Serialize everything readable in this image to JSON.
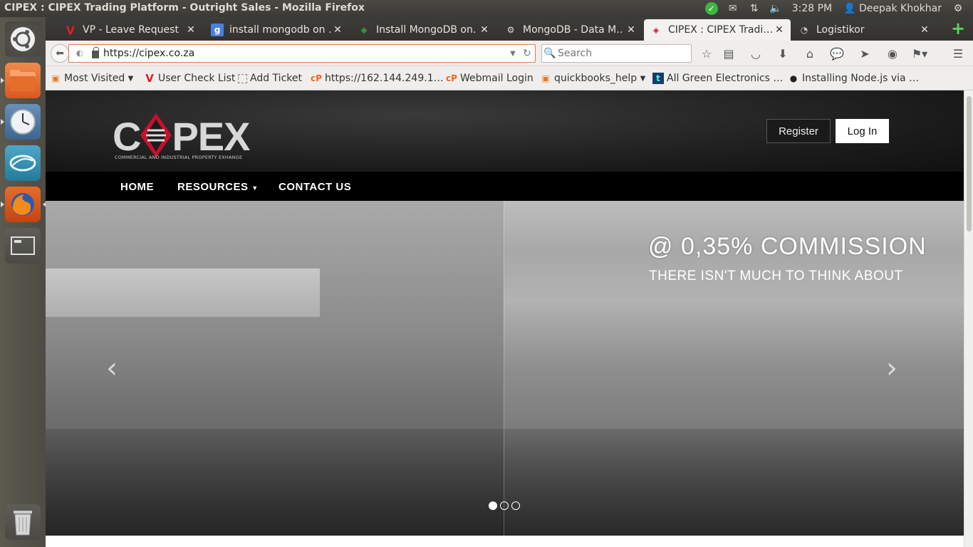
{
  "window": {
    "title": "CIPEX : CIPEX Trading Platform - Outright Sales - Mozilla Firefox"
  },
  "tray": {
    "time": "3:28 PM",
    "user": "Deepak Khokhar"
  },
  "tabs": [
    {
      "label": "VP - Leave Request",
      "favicon": "V"
    },
    {
      "label": "install mongodb on …",
      "favicon": "g"
    },
    {
      "label": "Install MongoDB on…",
      "favicon": "leaf"
    },
    {
      "label": "MongoDB - Data M…",
      "favicon": "gear"
    },
    {
      "label": "CIPEX : CIPEX Tradi…",
      "favicon": "cipex"
    },
    {
      "label": "Logistikor",
      "favicon": "loading"
    }
  ],
  "navbar": {
    "url": "https://cipex.co.za",
    "search_placeholder": "Search"
  },
  "bookmarks": [
    {
      "label": "Most Visited",
      "dropdown": true
    },
    {
      "label": "User Check List"
    },
    {
      "label": "Add Ticket"
    },
    {
      "label": "https://162.144.249.1…"
    },
    {
      "label": "Webmail Login"
    },
    {
      "label": "quickbooks_help",
      "dropdown": true
    },
    {
      "label": "All Green Electronics …"
    },
    {
      "label": "Installing Node.js via …"
    }
  ],
  "site": {
    "logo_text": "CIPEX",
    "logo_tagline": "COMMERCIAL AND INDUSTRIAL PROPERTY EXHANGE",
    "register_label": "Register",
    "login_label": "Log In",
    "nav": {
      "home": "HOME",
      "resources": "RESOURCES",
      "contact": "CONTACT US"
    },
    "hero": {
      "caption_main": "@ 0,35% COMMISSION",
      "caption_sub": "THERE ISN'T MUCH TO THINK ABOUT",
      "slide_count": 3,
      "active_slide": 1
    }
  },
  "colors": {
    "accent_red": "#c8102e",
    "url_border": "#e07a4a",
    "new_tab_green": "#5fd35f"
  }
}
